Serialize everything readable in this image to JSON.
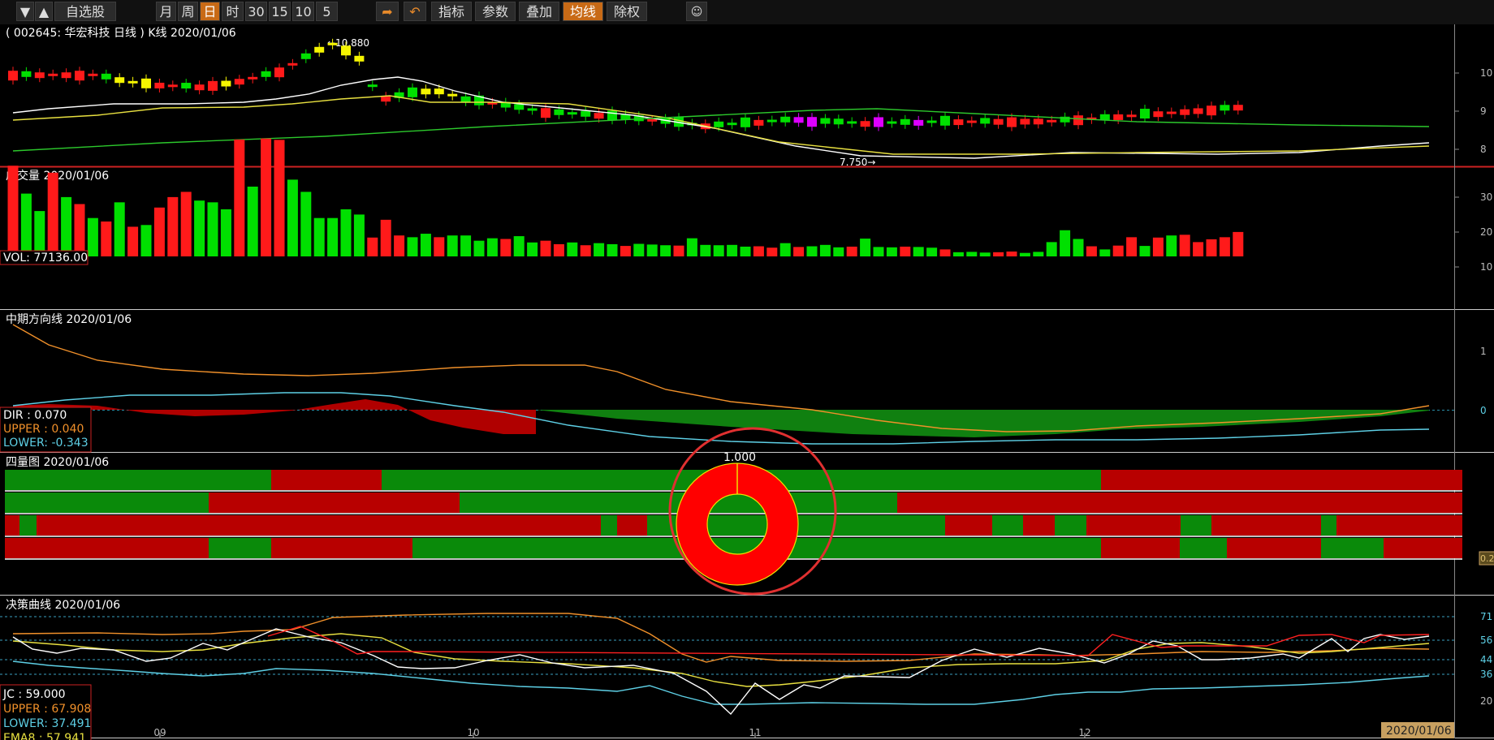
{
  "toolbar": {
    "down_arrow": "▼",
    "up_arrow": "▲",
    "watchlist": "自选股",
    "periods": [
      "月",
      "周",
      "日",
      "时",
      "30",
      "15",
      "10",
      "5"
    ],
    "active_period": "日",
    "indicator": "指标",
    "params": "参数",
    "overlay": "叠加",
    "ma": "均线",
    "exright": "除权"
  },
  "kline": {
    "title": "( 002645: 华宏科技 日线 )  K线 2020/01/06",
    "high_label": "←10.880",
    "low_label": "7.750→",
    "y_ticks": [
      "10",
      "9",
      "8"
    ]
  },
  "volume": {
    "title": "成交量 2020/01/06",
    "readout": "VOL: 77136.00",
    "y_ticks": [
      "30",
      "20",
      "10"
    ]
  },
  "dir": {
    "title": "中期方向线 2020/01/06",
    "readout": [
      {
        "label": "DIR      : 0.070",
        "color": "#ffffff"
      },
      {
        "label": "UPPER : 0.040",
        "color": "#f0902a"
      },
      {
        "label": "LOWER: -0.343",
        "color": "#5ed0e6"
      }
    ],
    "y_ticks": [
      "1",
      "0"
    ]
  },
  "quad": {
    "title": "四量图 2020/01/06",
    "donut_value": "1.000",
    "right_tag": "0.2"
  },
  "jc": {
    "title": "决策曲线 2020/01/06",
    "readout": [
      {
        "label": "JC       : 59.000",
        "color": "#ffffff"
      },
      {
        "label": "UPPER : 67.908",
        "color": "#f0902a"
      },
      {
        "label": "LOWER: 37.491",
        "color": "#5ed0e6"
      },
      {
        "label": "EMA8   : 57.941",
        "color": "#e8e040"
      }
    ],
    "y_ticks": [
      "71",
      "56",
      "44",
      "36",
      "20"
    ]
  },
  "x_axis": {
    "months": [
      "09",
      "10",
      "11",
      "12"
    ],
    "current_date": "2020/01/06"
  },
  "colors": {
    "up": "#ff1a1a",
    "down": "#00e000",
    "accent": "#c86a16",
    "divider": "#cc2222"
  }
}
